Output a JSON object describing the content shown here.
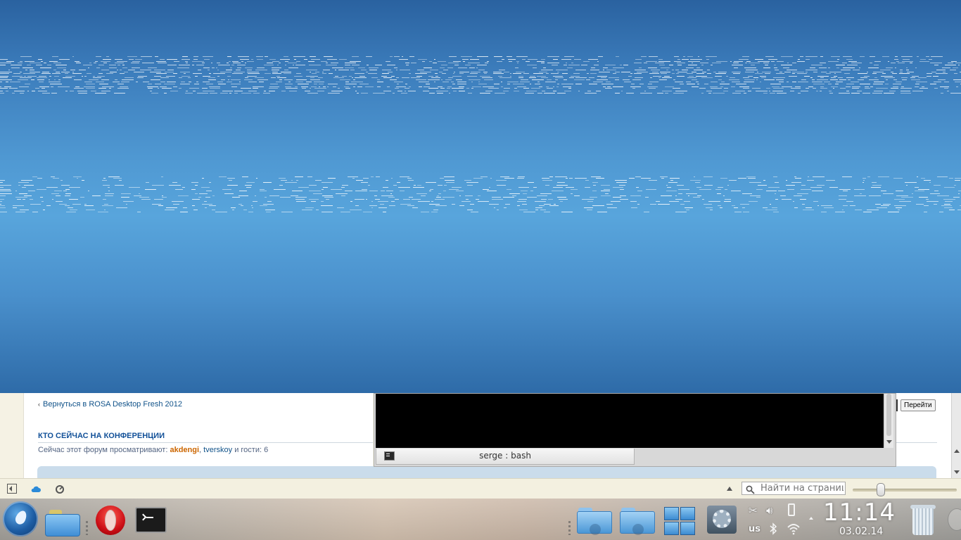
{
  "forum": {
    "back_link": "Вернуться в ROSA Desktop Fresh 2012",
    "online_heading": "КТО СЕЙЧАС НА КОНФЕРЕНЦИИ",
    "online_prefix": "Сейчас этот форум просматривают:",
    "online_user1": "akdengi",
    "online_sep": ",",
    "online_user2": "tverskoy",
    "online_suffix": "и гости: 6",
    "go_button": "Перейти"
  },
  "terminal": {
    "tab_title": "serge : bash"
  },
  "statusbar": {
    "search_placeholder": "Найти на страниц",
    "zoom_level": 0.25
  },
  "tray": {
    "keyboard_layout": "us"
  },
  "clock": {
    "time": "11:14",
    "date": "03.02.14"
  },
  "icons": {
    "launcher": "rosa-launcher-icon",
    "file_manager": "file-manager-icon",
    "browser": "opera-icon",
    "terminal": "konsole-icon",
    "downloads": "downloads-folder-icon",
    "documents": "documents-folder-icon",
    "windows": "windows-grid-icon",
    "settings": "settings-icon",
    "trash": "trash-icon"
  },
  "colors": {
    "wallpaper_top": "#2a62a0",
    "wallpaper_mid": "#58a5dc",
    "forum_link": "#105289",
    "forum_heading": "#115098",
    "online_user_highlight": "#cc6600",
    "terminal_bg": "#000000"
  }
}
